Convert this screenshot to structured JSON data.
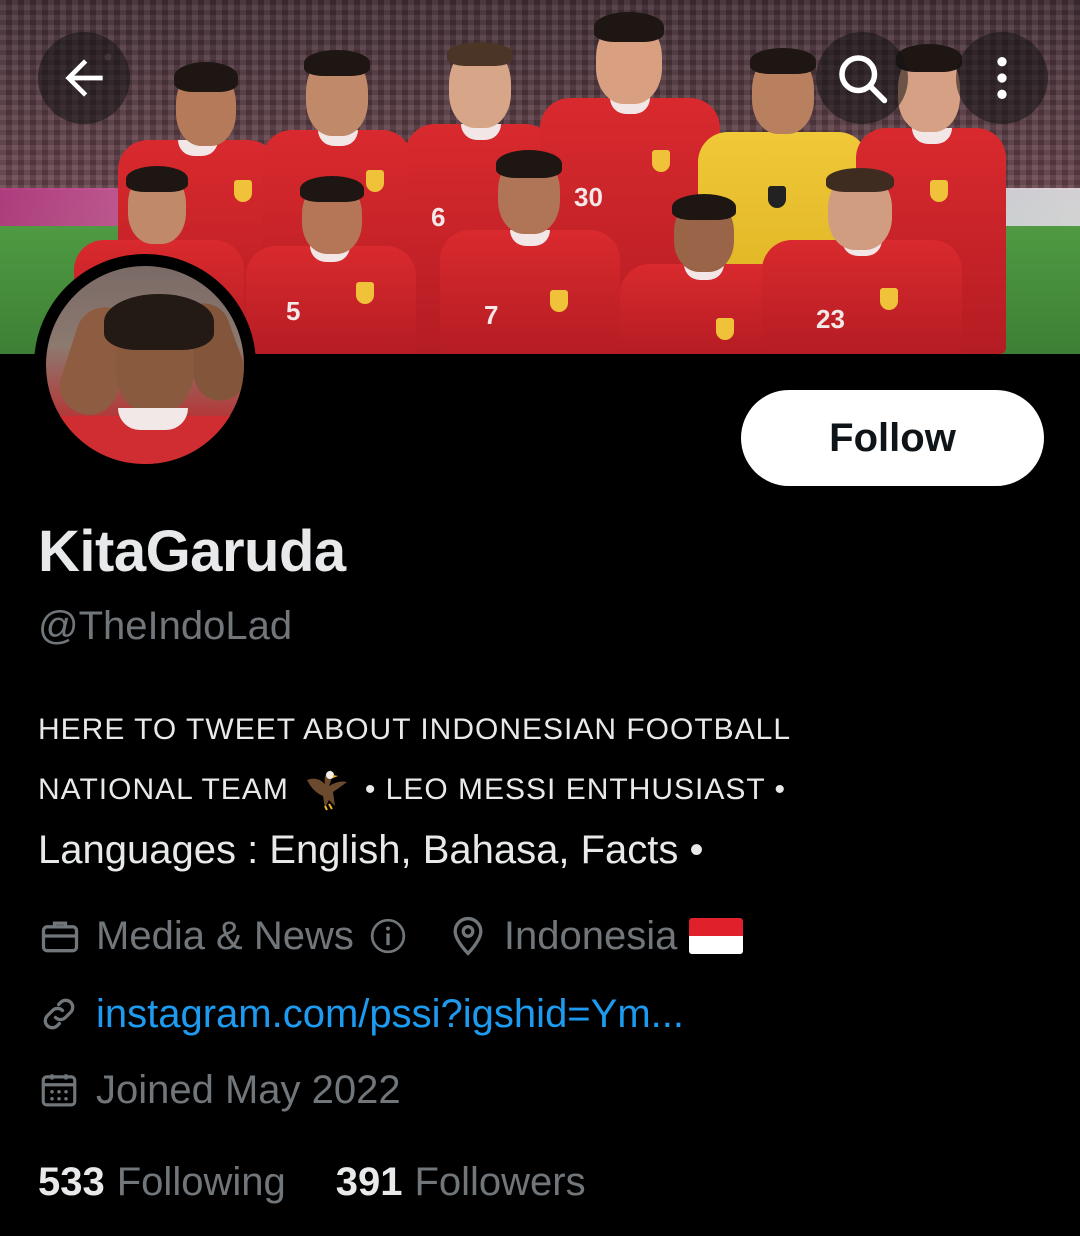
{
  "profile": {
    "display_name": "KitaGaruda",
    "handle": "@TheIndoLad",
    "follow_label": "Follow",
    "bio": {
      "line1": "HERE TO TWEET ABOUT INDONESIAN FOOTBALL",
      "line2_a": "NATIONAL TEAM",
      "line2_icon": "eagle-emoji",
      "line2_b": "• LEO MESSI ENTHUSIAST •",
      "line3": "Languages : English, Bahasa, Facts •"
    },
    "category": "Media & News",
    "location": "Indonesia",
    "location_flag": "indonesia-flag",
    "website": "instagram.com/pssi?igshid=Ym...",
    "joined": "Joined May 2022",
    "following_count": "533",
    "following_label": "Following",
    "followers_count": "391",
    "followers_label": "Followers"
  },
  "banner": {
    "jersey_numbers": [
      "5",
      "6",
      "7",
      "30",
      "23"
    ]
  },
  "icons": {
    "back": "arrow-left-icon",
    "search": "search-icon",
    "more": "more-vertical-icon",
    "category": "briefcase-icon",
    "info": "info-icon",
    "location": "location-pin-icon",
    "link": "link-icon",
    "calendar": "calendar-icon"
  },
  "colors": {
    "background": "#000000",
    "text_primary": "#e7e9ea",
    "text_secondary": "#71767b",
    "link": "#1d9bf0",
    "follow_bg": "#ffffff",
    "flag_red": "#e0202a",
    "flag_white": "#ffffff"
  }
}
